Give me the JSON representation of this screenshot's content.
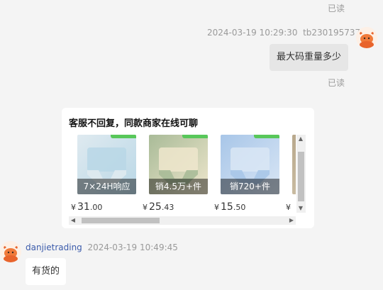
{
  "chat": {
    "read_status_top": "已读",
    "outgoing": {
      "timestamp": "2024-03-19 10:29:30",
      "sender": "tb230195737",
      "message": "最大码重量多少",
      "read_status": "已读"
    },
    "recommendation_card": {
      "title": "客服不回复，同款商家在线可聊",
      "products": [
        {
          "badge": "7×24H响应",
          "price_symbol": "¥",
          "price_int": "31",
          "price_dec": ".00",
          "colors": [
            "#dfeaf0",
            "#b9d7e6"
          ]
        },
        {
          "badge": "销4.5万+件",
          "price_symbol": "¥",
          "price_int": "25",
          "price_dec": ".43",
          "colors": [
            "#a9bb98",
            "#eee6cc"
          ]
        },
        {
          "badge": "销720+件",
          "price_symbol": "¥",
          "price_int": "15",
          "price_dec": ".50",
          "colors": [
            "#a8c6e8",
            "#d9e6f5"
          ]
        },
        {
          "badge": "",
          "price_symbol": "¥",
          "price_int": "",
          "price_dec": "",
          "colors": [
            "#b8a88c",
            "#d8ccb4"
          ]
        }
      ]
    },
    "incoming": {
      "sender": "danjietrading",
      "timestamp": "2024-03-19 10:49:45",
      "message": "有货的"
    }
  }
}
